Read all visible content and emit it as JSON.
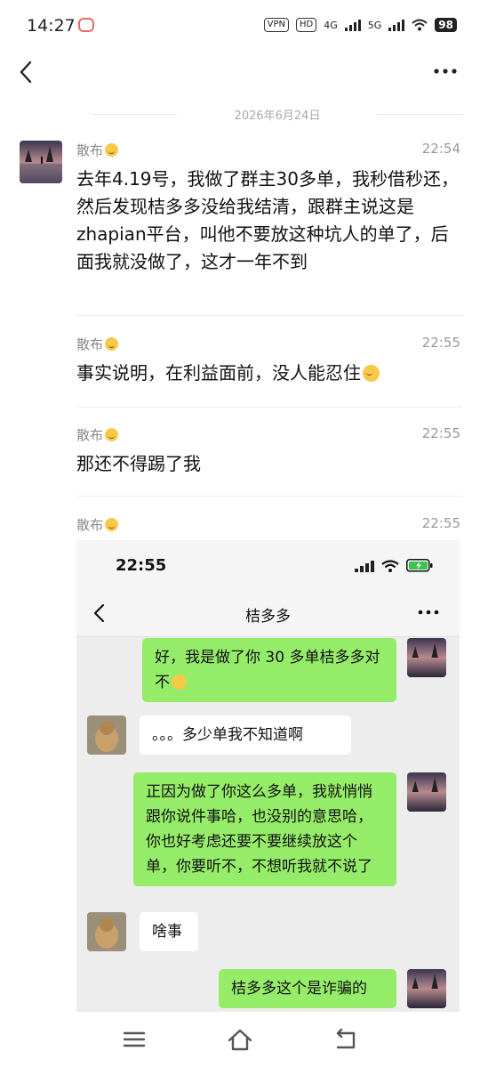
{
  "status_bar": {
    "time": "14:27",
    "vpn": "VPN",
    "hd": "HD",
    "net1": "4G",
    "net2": "5G",
    "battery": "98"
  },
  "date_separator": "2026年6月24日",
  "messages": [
    {
      "sender": "散布",
      "time": "22:54",
      "text": "去年4.19号，我做了群主30多单，我秒借秒还，然后发现桔多多没给我结清，跟群主说这是zhapian平台，叫他不要放这种坑人的单了，后面我就没做了，这才一年不到"
    },
    {
      "sender": "散布",
      "time": "22:55",
      "text": "事实说明，在利益面前，没人能忍住"
    },
    {
      "sender": "散布",
      "time": "22:55",
      "text": "那还不得踢了我"
    },
    {
      "sender": "散布",
      "time": "22:55"
    }
  ],
  "screenshot": {
    "time": "22:55",
    "title": "桔多多",
    "bubbles": [
      {
        "from": "me",
        "text": "好，我是做了你 30 多单桔多多对不"
      },
      {
        "from": "other",
        "text": "。。。多少单我不知道啊"
      },
      {
        "from": "me",
        "text": "正因为做了你这么多单，我就悄悄跟你说件事哈，也没别的意思哈，你也好考虑还要不要继续放这个单，你要听不，不想听我就不说了"
      },
      {
        "from": "other",
        "text": "啥事"
      },
      {
        "from": "me",
        "text": "桔多多这个是诈骗的"
      }
    ]
  },
  "colors": {
    "accent_green": "#95ec69",
    "background": "#ffffff",
    "screenshot_bg": "#ededed"
  },
  "icons": [
    "back-icon",
    "more-icon",
    "menu-icon",
    "home-icon",
    "return-icon",
    "wifi-icon",
    "signal-icon",
    "battery-icon"
  ]
}
